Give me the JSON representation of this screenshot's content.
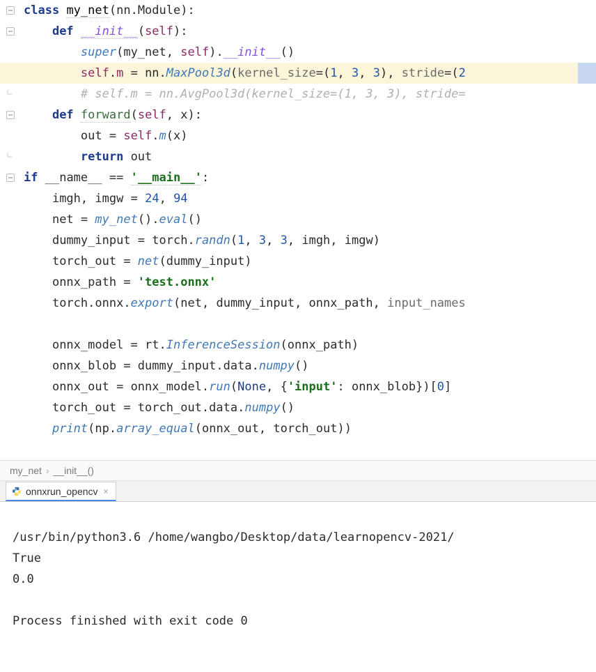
{
  "code": {
    "l1": {
      "class": "class",
      "name": "my_net",
      "paren_open": "(",
      "base": "nn.Module",
      "paren_close": "):"
    },
    "l2": {
      "def": "def",
      "name": "__init__",
      "args_open": "(",
      "self": "self",
      "args_close": "):"
    },
    "l3": {
      "super": "super",
      "open": "(",
      "a1": "my_net",
      "c": ",",
      "sp": " ",
      "self": "self",
      "close": ").",
      "init": "__init__",
      "p": "()"
    },
    "l4": {
      "self": "self",
      "dot": ".",
      "m": "m",
      "eq": " = ",
      "nn": "nn",
      "dot2": ".",
      "mp": "MaxPool3d",
      "open": "(",
      "k": "kernel_size",
      "eqk": "=(",
      "k1": "1",
      "c1": ", ",
      "k2": "3",
      "c2": ", ",
      "k3": "3",
      "closek": "), ",
      "s": "stride",
      "eqs": "=(",
      "s1": "2"
    },
    "l5": {
      "cmt": "# self.m = nn.AvgPool3d(kernel_size=(1, 3, 3), stride="
    },
    "l6": {
      "def": "def",
      "name": "forward",
      "open": "(",
      "self": "self",
      "c": ",",
      "sp": " ",
      "x": "x",
      "close": "):"
    },
    "l7": {
      "out": "out",
      "eq": " = ",
      "self": "self",
      "dot": ".",
      "m": "m",
      "open": "(",
      "x": "x",
      "close": ")"
    },
    "l8": {
      "ret": "return",
      "sp": " ",
      "out": "out"
    },
    "l9": {
      "ifkw": "if",
      "sp1": " ",
      "name": "__name__",
      "sp2": " == ",
      "str": "'__main__'",
      "colon": ":"
    },
    "l10": {
      "a": "imgh",
      "c": ",",
      "sp": " ",
      "b": "imgw",
      "eq": " = ",
      "v1": "24",
      "c2": ",",
      "sp2": " ",
      "v2": "94"
    },
    "l11": {
      "net": "net",
      "eq": " = ",
      "my": "my_net",
      "p1": "().",
      "ev": "eval",
      "p2": "()"
    },
    "l12": {
      "d": "dummy_input",
      "eq": " = ",
      "t": "torch",
      "dot": ".",
      "r": "randn",
      "open": "(",
      "n1": "1",
      "c1": ", ",
      "n2": "3",
      "c2": ", ",
      "n3": "3",
      "c3": ", ",
      "h": "imgh",
      "c4": ", ",
      "w": "imgw",
      "close": ")"
    },
    "l13": {
      "to": "torch_out",
      "eq": " = ",
      "net": "net",
      "open": "(",
      "d": "dummy_input",
      "close": ")"
    },
    "l14": {
      "op": "onnx_path",
      "eq": " = ",
      "s": "'test.onnx'"
    },
    "l15": {
      "t": "torch",
      "d1": ".",
      "o": "onnx",
      "d2": ".",
      "e": "export",
      "open": "(",
      "net": "net",
      "c1": ", ",
      "di": "dummy_input",
      "c2": ", ",
      "op": "onnx_path",
      "c3": ", ",
      "in": "input_names"
    },
    "l17": {
      "om": "onnx_model",
      "eq": " = ",
      "rt": "rt",
      "dot": ".",
      "is": "InferenceSession",
      "open": "(",
      "op": "onnx_path",
      "close": ")"
    },
    "l18": {
      "ob": "onnx_blob",
      "eq": " = ",
      "di": "dummy_input",
      "d1": ".",
      "da": "data",
      "d2": ".",
      "np": "numpy",
      "p": "()"
    },
    "l19": {
      "oo": "onnx_out",
      "eq": " = ",
      "om": "onnx_model",
      "d1": ".",
      "run": "run",
      "open": "(",
      "none": "None",
      "c1": ", {",
      "key": "'input'",
      "c2": ": ",
      "ob": "onnx_blob",
      "close": "})[",
      "idx": "0",
      "close2": "]"
    },
    "l20": {
      "to": "torch_out",
      "eq": " = ",
      "to2": "torch_out",
      "d1": ".",
      "da": "data",
      "d2": ".",
      "np": "numpy",
      "p": "()"
    },
    "l21": {
      "pr": "print",
      "open": "(",
      "np": "np",
      "d1": ".",
      "ae": "array_equal",
      "open2": "(",
      "oo": "onnx_out",
      "c": ", ",
      "to": "torch_out",
      "close": "))"
    }
  },
  "breadcrumb": {
    "a": "my_net",
    "sep": "›",
    "b": "__init__()"
  },
  "tab": {
    "label": "onnxrun_opencv",
    "close": "×"
  },
  "console": {
    "line1": "/usr/bin/python3.6 /home/wangbo/Desktop/data/learnopencv-2021/",
    "line2": "True",
    "line3": "0.0",
    "blank": "",
    "line4": "Process finished with exit code 0"
  }
}
